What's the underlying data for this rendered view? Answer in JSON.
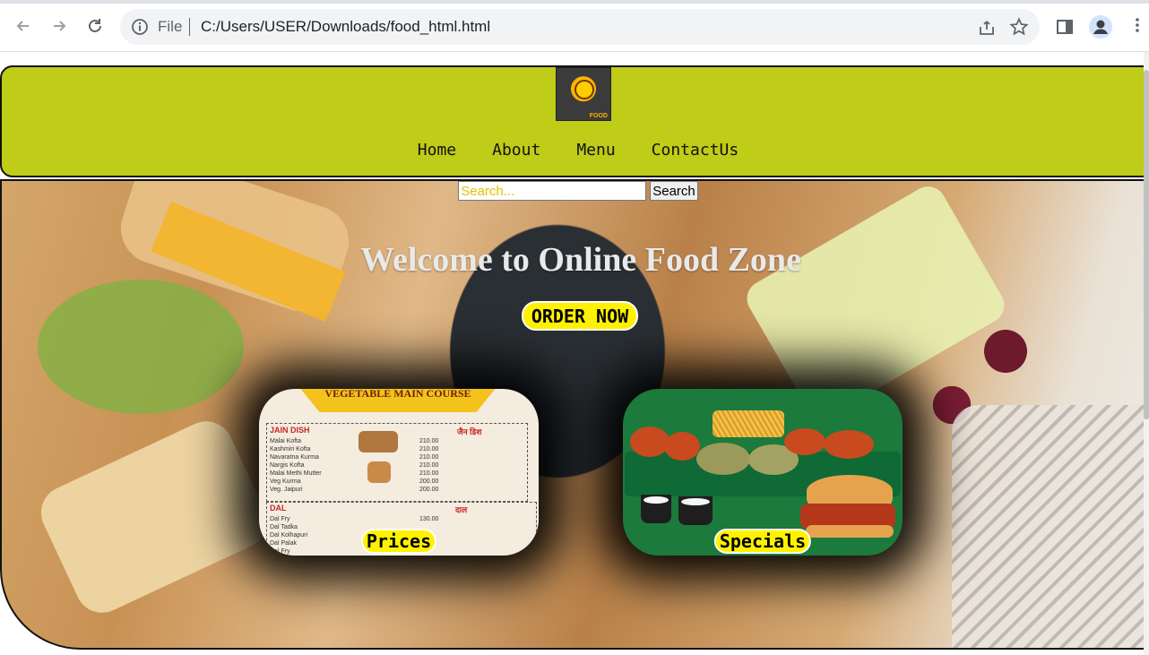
{
  "browser": {
    "scheme_label": "File",
    "url": "C:/Users/USER/Downloads/food_html.html"
  },
  "header": {
    "logo_text": "FOOD",
    "nav": [
      "Home",
      "About",
      "Menu",
      "ContactUs"
    ]
  },
  "search": {
    "placeholder": "Search...",
    "button_label": "Search"
  },
  "hero": {
    "title": "Welcome to Online Food Zone",
    "cta_label": "ORDER NOW"
  },
  "cards": {
    "prices": {
      "label": "Prices",
      "menu_heading": "VEGETABLE MAIN COURSE",
      "jain_title": "JAIN DISH",
      "jain_title_local": "जैन डिश",
      "jain_items": [
        "Malai Kofta",
        "Kashmiri Kofta",
        "Navaratna Kurma",
        "Nargis Kofta",
        "Malai Methi Mutter",
        "Veg Kurma",
        "Veg. Jaipuri"
      ],
      "jain_prices": [
        "210.00",
        "210.00",
        "210.00",
        "210.00",
        "210.00",
        "200.00",
        "200.00"
      ],
      "dal_title": "DAL",
      "dal_title_local": "दाल",
      "dal_items": [
        "Dal Fry",
        "Dal Tadka",
        "Dal Kolhapuri",
        "Dal Palak",
        "Dal Fry"
      ],
      "dal_prices": [
        "130.00"
      ]
    },
    "specials": {
      "label": "Specials"
    }
  },
  "colors": {
    "header_bg": "#bfcc18",
    "badge_bg": "#fff200",
    "search_placeholder": "#e6c200"
  }
}
